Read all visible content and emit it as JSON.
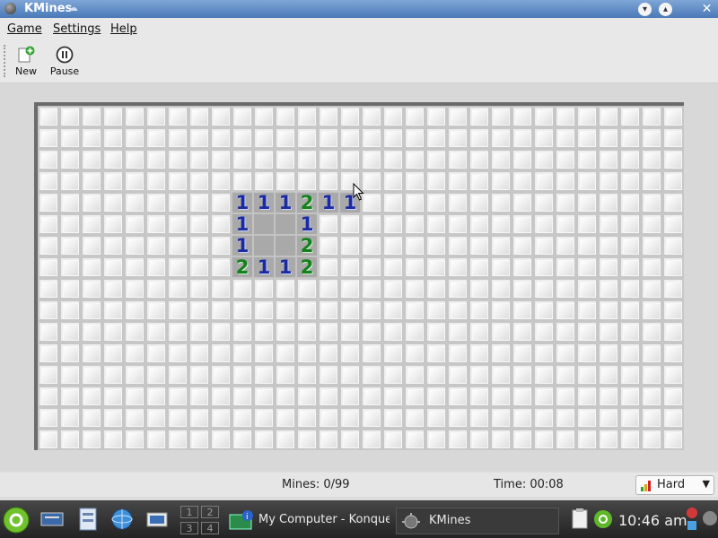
{
  "window": {
    "title": "KMines"
  },
  "menu": {
    "items": [
      "Game",
      "Settings",
      "Help"
    ]
  },
  "toolbar": {
    "new_label": "New",
    "pause_label": "Pause"
  },
  "board": {
    "columns": 30,
    "rows": 16,
    "revealed": [
      {
        "row": 4,
        "col": 9,
        "value": "1"
      },
      {
        "row": 4,
        "col": 10,
        "value": "1"
      },
      {
        "row": 4,
        "col": 11,
        "value": "1"
      },
      {
        "row": 4,
        "col": 12,
        "value": "2"
      },
      {
        "row": 4,
        "col": 13,
        "value": "1"
      },
      {
        "row": 4,
        "col": 14,
        "value": "1"
      },
      {
        "row": 5,
        "col": 9,
        "value": "1"
      },
      {
        "row": 5,
        "col": 10,
        "value": ""
      },
      {
        "row": 5,
        "col": 11,
        "value": ""
      },
      {
        "row": 5,
        "col": 12,
        "value": "1"
      },
      {
        "row": 6,
        "col": 9,
        "value": "1"
      },
      {
        "row": 6,
        "col": 10,
        "value": ""
      },
      {
        "row": 6,
        "col": 11,
        "value": ""
      },
      {
        "row": 6,
        "col": 12,
        "value": "2"
      },
      {
        "row": 7,
        "col": 9,
        "value": "2"
      },
      {
        "row": 7,
        "col": 10,
        "value": "1"
      },
      {
        "row": 7,
        "col": 11,
        "value": "1"
      },
      {
        "row": 7,
        "col": 12,
        "value": "2"
      }
    ]
  },
  "status": {
    "mines": "Mines: 0/99",
    "time": "Time: 00:08",
    "difficulty": "Hard"
  },
  "taskbar": {
    "pager": [
      "1",
      "2",
      "3",
      "4"
    ],
    "tasks": [
      "My Computer - Konquer",
      "KMines"
    ],
    "clock": "10:46 am"
  },
  "colors": {
    "one": "#1b2aa0",
    "two": "#14801d",
    "titlebar": "#4a78b8"
  }
}
